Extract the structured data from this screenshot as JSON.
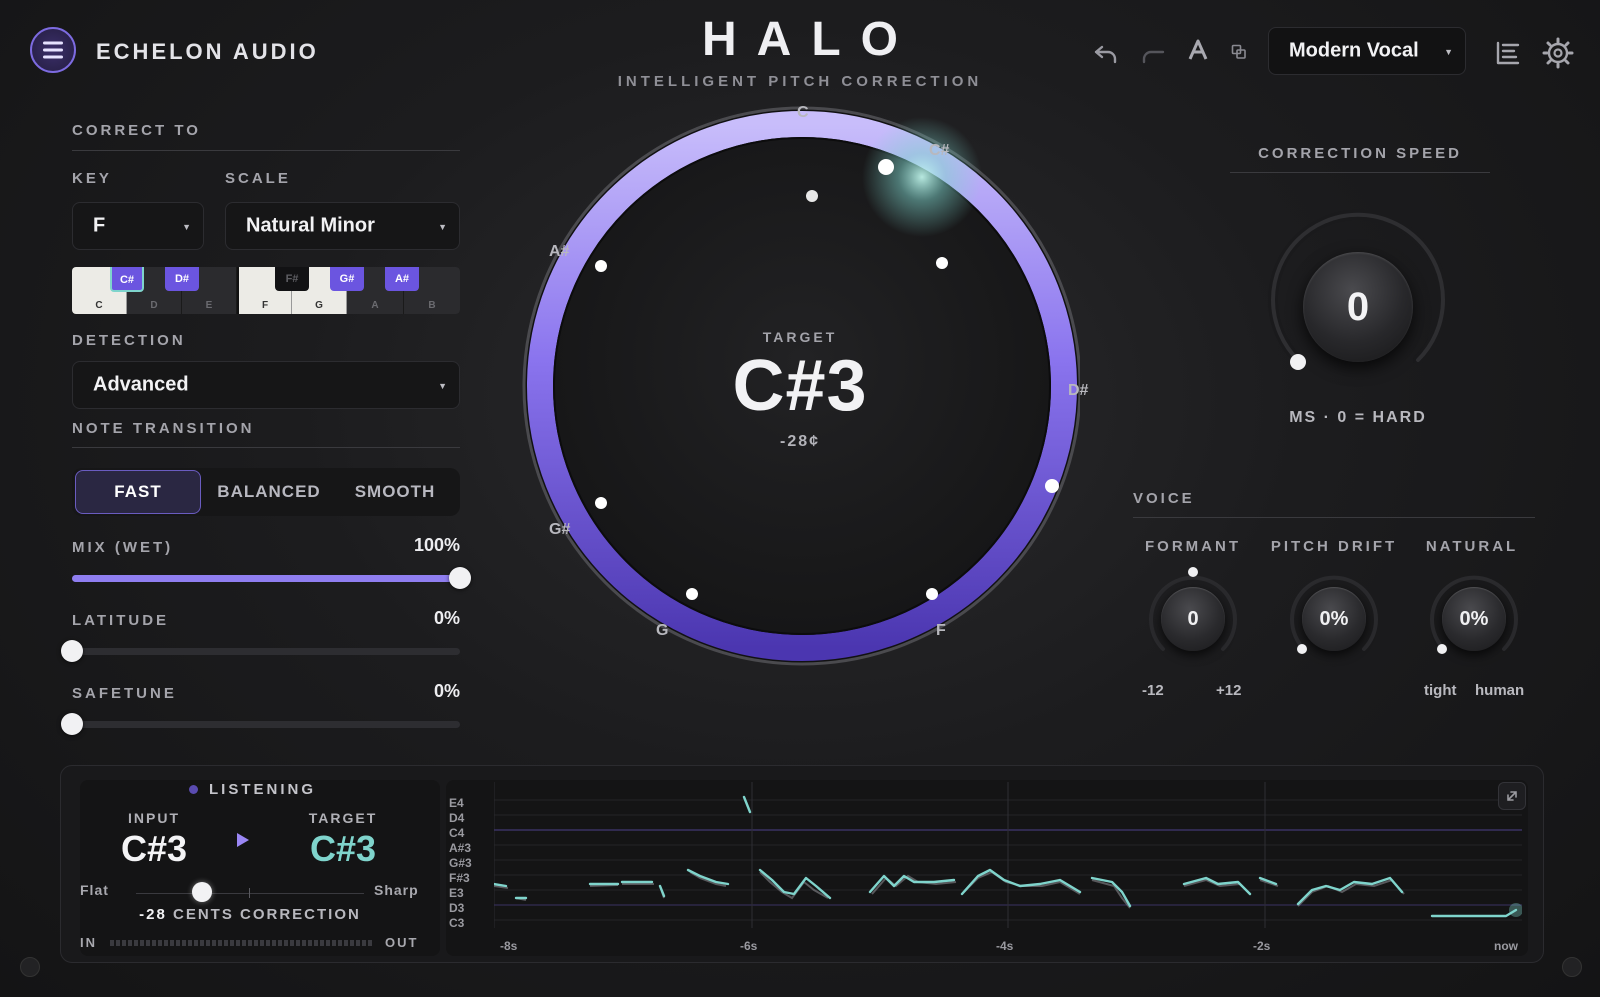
{
  "header": {
    "brand": "ECHELON AUDIO",
    "product": "HALO",
    "subtitle": "INTELLIGENT PITCH CORRECTION",
    "preset": "Modern Vocal"
  },
  "correct_to": {
    "title": "CORRECT TO",
    "key_label": "KEY",
    "key_value": "F",
    "scale_label": "SCALE",
    "scale_value": "Natural Minor",
    "white_keys": [
      "C",
      "D",
      "E",
      "F",
      "G",
      "A",
      "B"
    ],
    "black_keys": [
      "C#",
      "D#",
      "F#",
      "G#",
      "A#"
    ]
  },
  "detection": {
    "label": "DETECTION",
    "value": "Advanced"
  },
  "note_transition": {
    "label": "NOTE TRANSITION",
    "options": [
      "FAST",
      "BALANCED",
      "SMOOTH"
    ],
    "selected": "FAST"
  },
  "sliders": {
    "mix_label": "MIX (WET)",
    "mix_value": "100%",
    "mix_fraction": 1.0,
    "latitude_label": "LATITUDE",
    "latitude_value": "0%",
    "latitude_fraction": 0.0,
    "safetune_label": "SAFETUNE",
    "safetune_value": "0%",
    "safetune_fraction": 0.0
  },
  "wheel": {
    "target_label": "TARGET",
    "target_note": "C#3",
    "cents": "-28¢",
    "note_labels": [
      "C",
      "C#",
      "D#",
      "F",
      "G",
      "G#",
      "A#"
    ]
  },
  "correction_speed": {
    "title": "CORRECTION SPEED",
    "value": "0",
    "caption": "MS · 0 = HARD"
  },
  "voice": {
    "title": "VOICE",
    "formant_label": "FORMANT",
    "formant_value": "0",
    "formant_min": "-12",
    "formant_max": "+12",
    "drift_label": "PITCH DRIFT",
    "drift_value": "0%",
    "natural_label": "NATURAL",
    "natural_value": "0%",
    "natural_min": "tight",
    "natural_max": "human"
  },
  "monitor": {
    "status": "LISTENING",
    "input_label": "INPUT",
    "input_note": "C#3",
    "target_label": "TARGET",
    "target_note": "C#3",
    "flat_label": "Flat",
    "sharp_label": "Sharp",
    "cents_value": "-28",
    "cents_text": "CENTS CORRECTION",
    "in_label": "IN",
    "out_label": "OUT",
    "accent": "#7fd4cc"
  },
  "history": {
    "pitch_labels": [
      "E4",
      "D4",
      "C4",
      "A#3",
      "G#3",
      "F#3",
      "E3",
      "D3",
      "C3"
    ],
    "time_labels": [
      "-8s",
      "-6s",
      "-4s",
      "-2s",
      "now"
    ]
  },
  "colors": {
    "accent_purple": "#8f7ef0",
    "accent_teal": "#7fd4cc"
  }
}
